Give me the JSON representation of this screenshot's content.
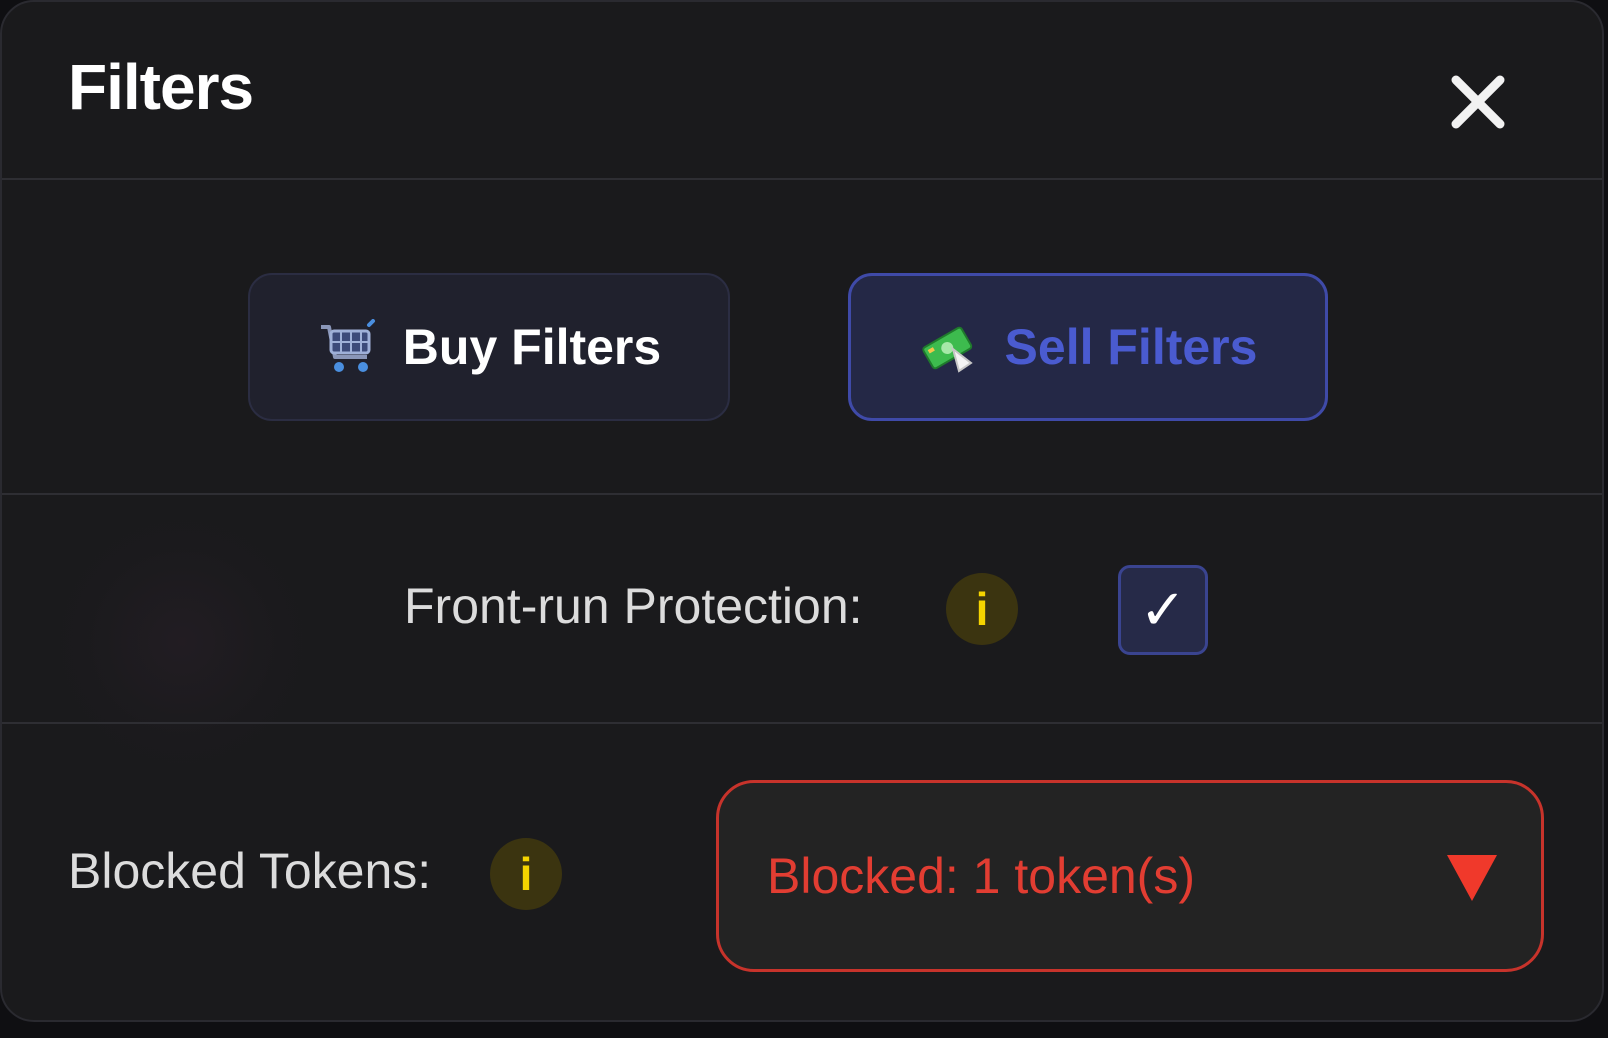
{
  "header": {
    "title": "Filters",
    "close_icon": "close-icon"
  },
  "tabs": [
    {
      "label": "Buy Filters",
      "icon": "shopping-cart-icon",
      "active": false
    },
    {
      "label": "Sell Filters",
      "icon": "money-with-wings-icon",
      "active": true
    }
  ],
  "front_run": {
    "label": "Front-run Protection:",
    "info_glyph": "i",
    "checked": true,
    "check_glyph": "✓"
  },
  "blocked_tokens": {
    "label": "Blocked Tokens:",
    "info_glyph": "i",
    "value": "Blocked: 1 token(s)",
    "dropdown_icon": "triangle-down-icon"
  },
  "colors": {
    "background": "#1a1a1c",
    "accent": "#4a5bd0",
    "info": "#f5d400",
    "danger": "#e23d32"
  }
}
